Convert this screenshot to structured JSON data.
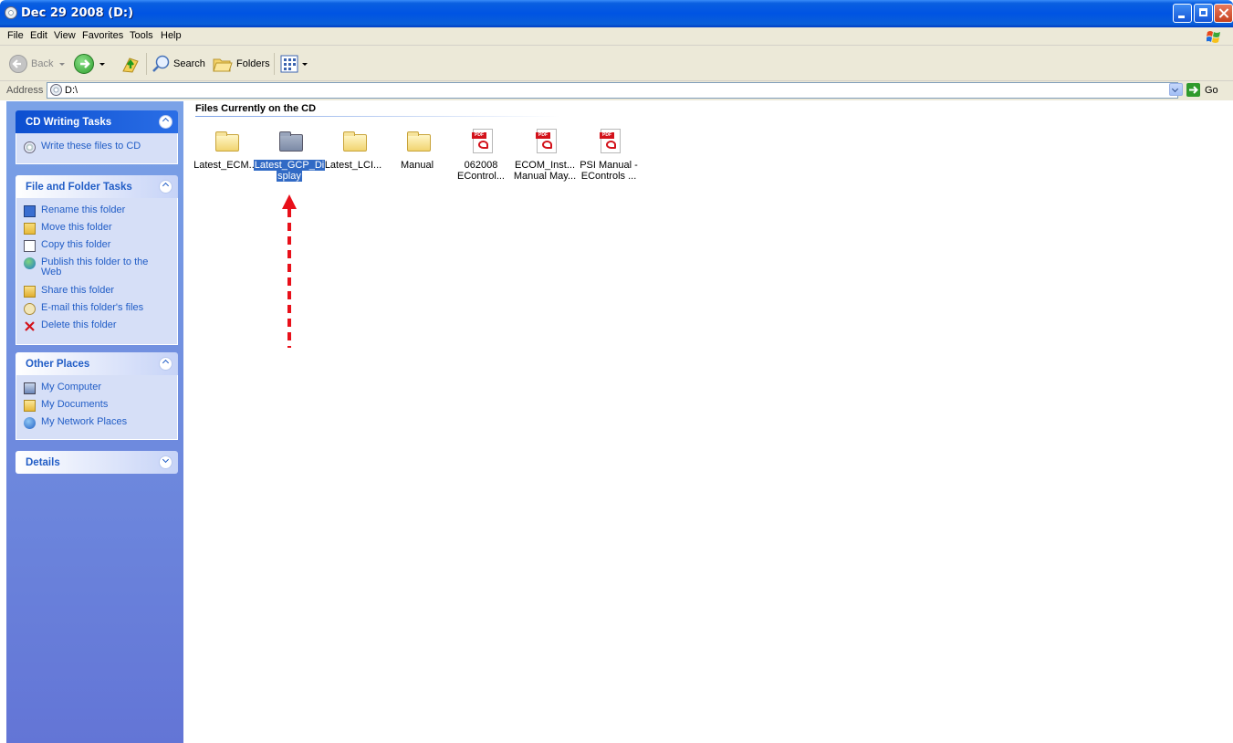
{
  "window": {
    "title": "Dec 29 2008 (D:)"
  },
  "menu": [
    "File",
    "Edit",
    "View",
    "Favorites",
    "Tools",
    "Help"
  ],
  "toolbar": {
    "back_label": "Back",
    "search_label": "Search",
    "folders_label": "Folders"
  },
  "address": {
    "label": "Address",
    "value": "D:\\",
    "go_label": "Go"
  },
  "tasks": {
    "cd_writing": {
      "title": "CD Writing Tasks",
      "items": [
        "Write these files to CD"
      ]
    },
    "file_folder": {
      "title": "File and Folder Tasks",
      "items": [
        "Rename this folder",
        "Move this folder",
        "Copy this folder",
        "Publish this folder to the Web",
        "Share this folder",
        "E-mail this folder's files",
        "Delete this folder"
      ]
    },
    "other_places": {
      "title": "Other Places",
      "items": [
        "My Computer",
        "My Documents",
        "My Network Places"
      ]
    },
    "details": {
      "title": "Details"
    }
  },
  "content": {
    "group_title": "Files Currently on the CD",
    "items": [
      {
        "line1": "Latest_ECM...",
        "line2": ""
      },
      {
        "line1": "Latest_GCP_Di",
        "line2": "splay"
      },
      {
        "line1": "Latest_LCI...",
        "line2": ""
      },
      {
        "line1": "Manual",
        "line2": ""
      },
      {
        "line1": "062008",
        "line2": "EControl..."
      },
      {
        "line1": "ECOM_Inst...",
        "line2": "Manual May..."
      },
      {
        "line1": "PSI Manual -",
        "line2": "EControls ..."
      }
    ]
  },
  "icons": {
    "pdf_badge": "PDF"
  },
  "colors": {
    "titlebar": "#0054e3",
    "selection": "#316ac5",
    "link": "#215dc6",
    "arrow": "#e8101a"
  }
}
